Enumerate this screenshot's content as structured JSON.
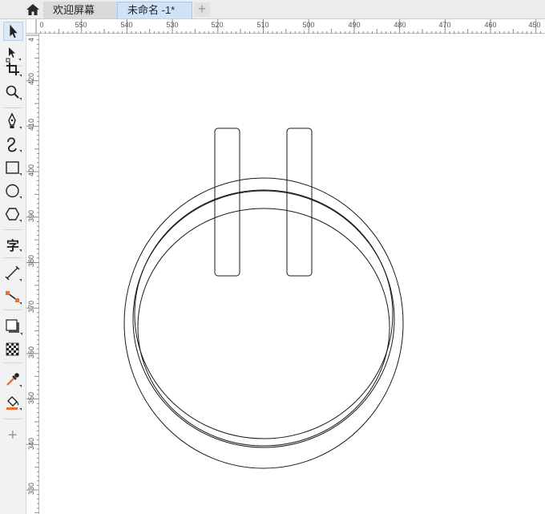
{
  "tabs": [
    {
      "label": "欢迎屏幕",
      "active": false
    },
    {
      "label": "未命名 -1*",
      "active": true
    }
  ],
  "add_tab_label": "+",
  "home_icon": "home-icon",
  "toolbox": [
    {
      "name": "pick-tool",
      "icon": "arrow-pointer-icon",
      "selected": true
    },
    {
      "name": "shape-tool",
      "icon": "node-edit-icon"
    },
    {
      "name": "crop-tool",
      "icon": "crop-icon"
    },
    {
      "name": "zoom-tool",
      "icon": "magnifier-icon"
    },
    {
      "name": "pen-tool",
      "icon": "pen-nib-icon"
    },
    {
      "name": "artistic-media-tool",
      "icon": "curve-brush-icon"
    },
    {
      "name": "rectangle-tool",
      "icon": "rectangle-icon"
    },
    {
      "name": "ellipse-tool",
      "icon": "ellipse-icon"
    },
    {
      "name": "polygon-tool",
      "icon": "hexagon-icon"
    },
    {
      "name": "text-tool",
      "icon": "text-icon",
      "glyph": "字"
    },
    {
      "name": "dimension-tool",
      "icon": "dimension-line-icon"
    },
    {
      "name": "connector-tool",
      "icon": "connector-icon"
    },
    {
      "name": "drop-shadow-tool",
      "icon": "drop-shadow-icon"
    },
    {
      "name": "transparency-tool",
      "icon": "checkerboard-icon"
    },
    {
      "name": "eyedropper-tool",
      "icon": "eyedropper-icon"
    },
    {
      "name": "interactive-fill-tool",
      "icon": "paint-bucket-icon"
    },
    {
      "name": "add-tool",
      "icon": "plus-icon",
      "glyph": "+"
    }
  ],
  "ruler": {
    "horizontal_labels": [
      "0",
      "550",
      "540",
      "530",
      "520",
      "510",
      "500",
      "490",
      "480",
      "470",
      "460",
      "450"
    ],
    "vertical_labels": [
      "4",
      "420",
      "410",
      "400",
      "390",
      "380",
      "370",
      "360",
      "350",
      "340",
      "330"
    ]
  },
  "colors": {
    "accent_tab": "#cfe2f7",
    "shape_stroke": "#1a1a1a",
    "fill_tool_orange": "#e8702a"
  }
}
